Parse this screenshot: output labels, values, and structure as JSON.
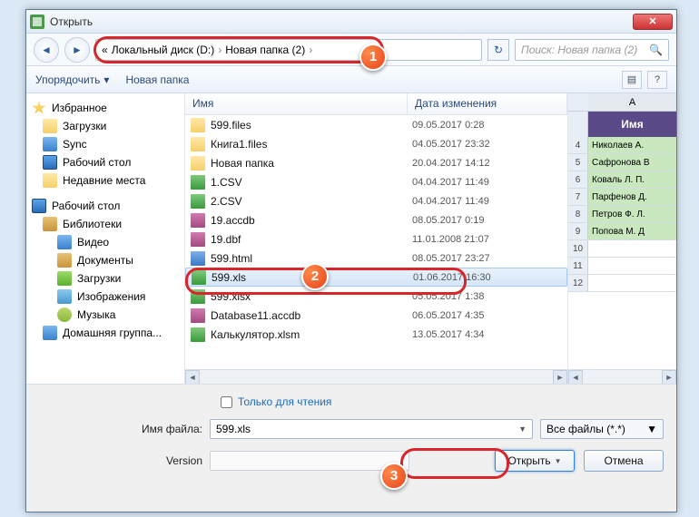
{
  "window": {
    "title": "Открыть",
    "close": "✕"
  },
  "nav": {
    "back": "◄",
    "fwd": "►",
    "crumb_prefix": "«",
    "crumb1": "Локальный диск (D:)",
    "crumb2": "Новая папка (2)",
    "sep": "›",
    "refresh": "↻",
    "search_placeholder": "Поиск: Новая папка (2)"
  },
  "toolbar": {
    "organize": "Упорядочить",
    "organize_dd": "▾",
    "newfolder": "Новая папка",
    "view": "▤",
    "help": "?"
  },
  "sidebar": {
    "fav": "Избранное",
    "fav_items": [
      "Загрузки",
      "Sync",
      "Рабочий стол",
      "Недавние места"
    ],
    "desk": "Рабочий стол",
    "lib": "Библиотеки",
    "lib_items": [
      "Видео",
      "Документы",
      "Загрузки",
      "Изображения",
      "Музыка"
    ],
    "homegroup": "Домашняя группа..."
  },
  "filelist": {
    "col_name": "Имя",
    "col_date": "Дата изменения",
    "rows": [
      {
        "ic": "fold",
        "nm": "599.files",
        "dt": "09.05.2017 0:28"
      },
      {
        "ic": "fold",
        "nm": "Книга1.files",
        "dt": "04.05.2017 23:32"
      },
      {
        "ic": "fold",
        "nm": "Новая папка",
        "dt": "20.04.2017 14:12"
      },
      {
        "ic": "xls",
        "nm": "1.CSV",
        "dt": "04.04.2017 11:49"
      },
      {
        "ic": "xls",
        "nm": "2.CSV",
        "dt": "04.04.2017 11:49"
      },
      {
        "ic": "db",
        "nm": "19.accdb",
        "dt": "08.05.2017 0:19"
      },
      {
        "ic": "db",
        "nm": "19.dbf",
        "dt": "11.01.2008 21:07"
      },
      {
        "ic": "htm",
        "nm": "599.html",
        "dt": "08.05.2017 23:27"
      },
      {
        "ic": "xls",
        "nm": "599.xls",
        "dt": "01.06.2017 16:30",
        "sel": true
      },
      {
        "ic": "xls",
        "nm": "599.xlsx",
        "dt": "05.05.2017 1:38"
      },
      {
        "ic": "db",
        "nm": "Database11.accdb",
        "dt": "06.05.2017 4:35"
      },
      {
        "ic": "xls",
        "nm": "Калькулятор.xlsm",
        "dt": "13.05.2017 4:34"
      }
    ]
  },
  "preview": {
    "col": "A",
    "title": "Имя",
    "rows": [
      {
        "n": "4",
        "v": "Николаев А."
      },
      {
        "n": "5",
        "v": "Сафронова В"
      },
      {
        "n": "6",
        "v": "Коваль Л. П."
      },
      {
        "n": "7",
        "v": "Парфенов Д."
      },
      {
        "n": "8",
        "v": "Петров Ф. Л.",
        "sel": true
      },
      {
        "n": "9",
        "v": "Попова М. Д"
      }
    ],
    "empty_rows": [
      "10",
      "11",
      "12"
    ]
  },
  "bottom": {
    "readonly": "Только для чтения",
    "filename_lbl": "Имя файла:",
    "filename_val": "599.xls",
    "filter": "Все файлы (*.*)",
    "version_lbl": "Version",
    "open": "Открыть",
    "cancel": "Отмена"
  },
  "badges": {
    "b1": "1",
    "b2": "2",
    "b3": "3"
  }
}
